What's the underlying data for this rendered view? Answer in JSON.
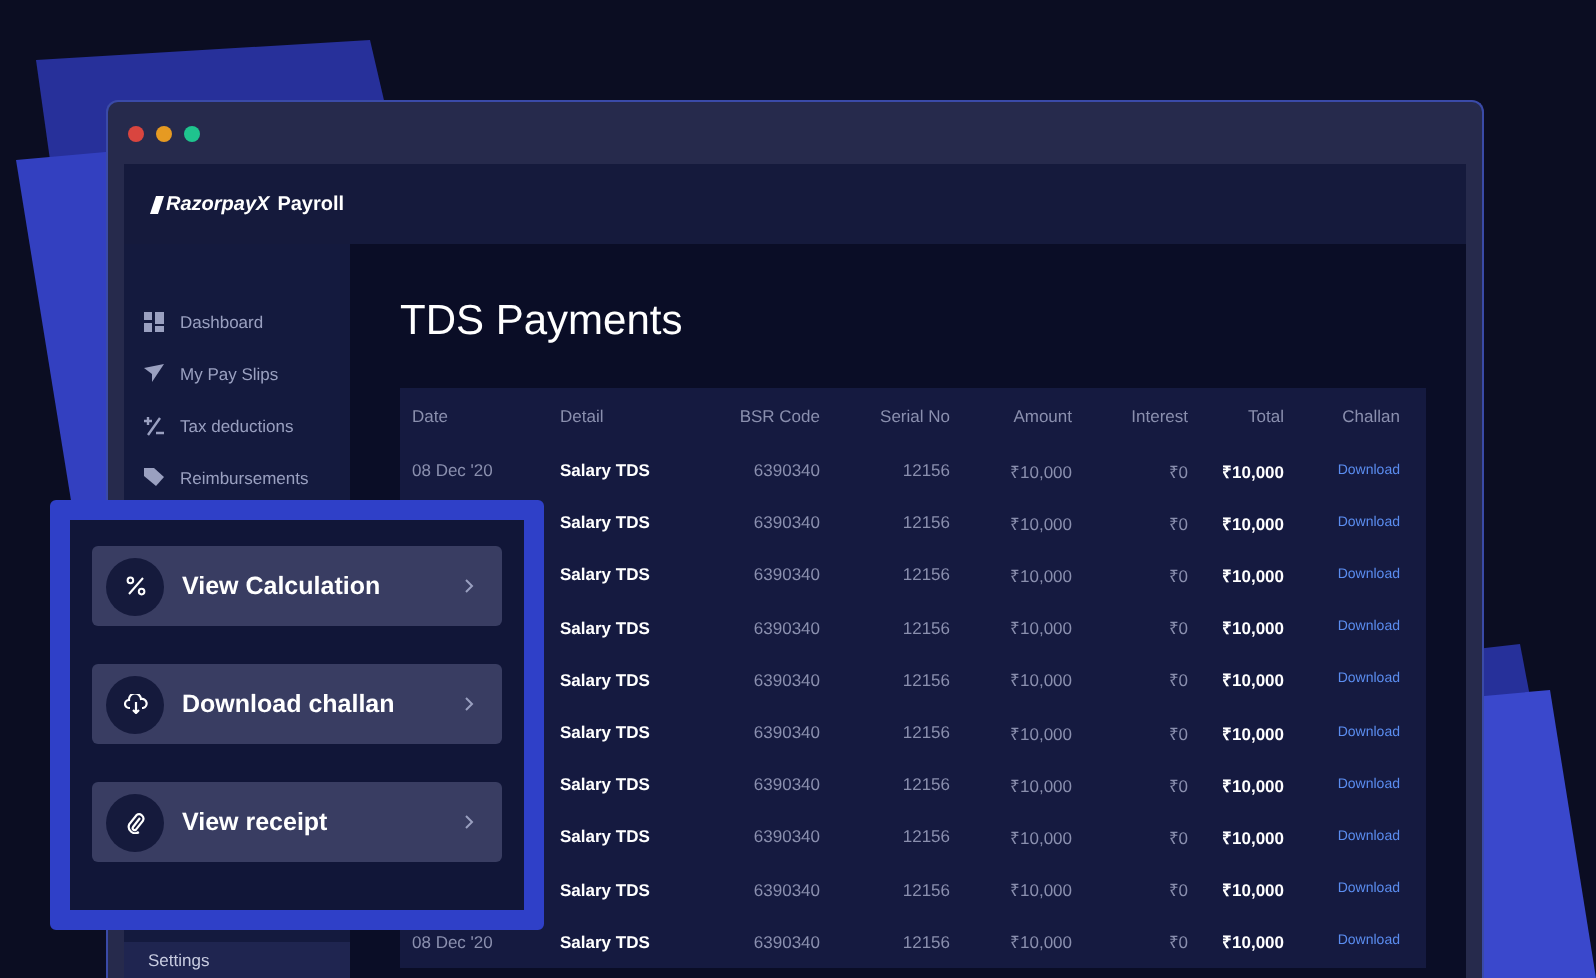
{
  "window": {
    "brand": "RazorpayX",
    "product": "Payroll"
  },
  "sidebar": {
    "items": [
      {
        "label": "Dashboard",
        "kind": "grid",
        "selected": false
      },
      {
        "label": "My Pay Slips",
        "kind": "plane",
        "selected": false
      },
      {
        "label": "Tax deductions",
        "kind": "plusminus",
        "selected": false
      },
      {
        "label": "Reimbursements",
        "kind": "tag",
        "selected": false
      }
    ],
    "bottom_items": [
      {
        "label": "Settings",
        "selected": true
      }
    ]
  },
  "page": {
    "title": "TDS Payments"
  },
  "table": {
    "columns": [
      "Date",
      "Detail",
      "BSR Code",
      "Serial No",
      "Amount",
      "Interest",
      "Total",
      "Challan"
    ],
    "rows": [
      {
        "date": "08 Dec '20",
        "detail": "Salary TDS",
        "bsr": "6390340",
        "serial": "12156",
        "amount": "₹10,000",
        "interest": "₹0",
        "total": "₹10,000",
        "challan": "Download"
      },
      {
        "detail": "Salary TDS",
        "bsr": "6390340",
        "serial": "12156",
        "amount": "₹10,000",
        "interest": "₹0",
        "total": "₹10,000",
        "challan": "Download"
      },
      {
        "detail": "Salary TDS",
        "bsr": "6390340",
        "serial": "12156",
        "amount": "₹10,000",
        "interest": "₹0",
        "total": "₹10,000",
        "challan": "Download"
      },
      {
        "detail": "Salary TDS",
        "bsr": "6390340",
        "serial": "12156",
        "amount": "₹10,000",
        "interest": "₹0",
        "total": "₹10,000",
        "challan": "Download"
      },
      {
        "detail": "Salary TDS",
        "bsr": "6390340",
        "serial": "12156",
        "amount": "₹10,000",
        "interest": "₹0",
        "total": "₹10,000",
        "challan": "Download"
      },
      {
        "detail": "Salary TDS",
        "bsr": "6390340",
        "serial": "12156",
        "amount": "₹10,000",
        "interest": "₹0",
        "total": "₹10,000",
        "challan": "Download"
      },
      {
        "detail": "Salary TDS",
        "bsr": "6390340",
        "serial": "12156",
        "amount": "₹10,000",
        "interest": "₹0",
        "total": "₹10,000",
        "challan": "Download"
      },
      {
        "detail": "Salary TDS",
        "bsr": "6390340",
        "serial": "12156",
        "amount": "₹10,000",
        "interest": "₹0",
        "total": "₹10,000",
        "challan": "Download"
      },
      {
        "detail": "Salary TDS",
        "bsr": "6390340",
        "serial": "12156",
        "amount": "₹10,000",
        "interest": "₹0",
        "total": "₹10,000",
        "challan": "Download"
      },
      {
        "date": "08 Dec '20",
        "detail": "Salary TDS",
        "bsr": "6390340",
        "serial": "12156",
        "amount": "₹10,000",
        "interest": "₹0",
        "total": "₹10,000",
        "challan": "Download"
      }
    ]
  },
  "popup": {
    "actions": [
      {
        "label": "View Calculation",
        "kind": "percent"
      },
      {
        "label": "Download challan",
        "kind": "cloud"
      },
      {
        "label": "View receipt",
        "kind": "clip"
      }
    ]
  }
}
